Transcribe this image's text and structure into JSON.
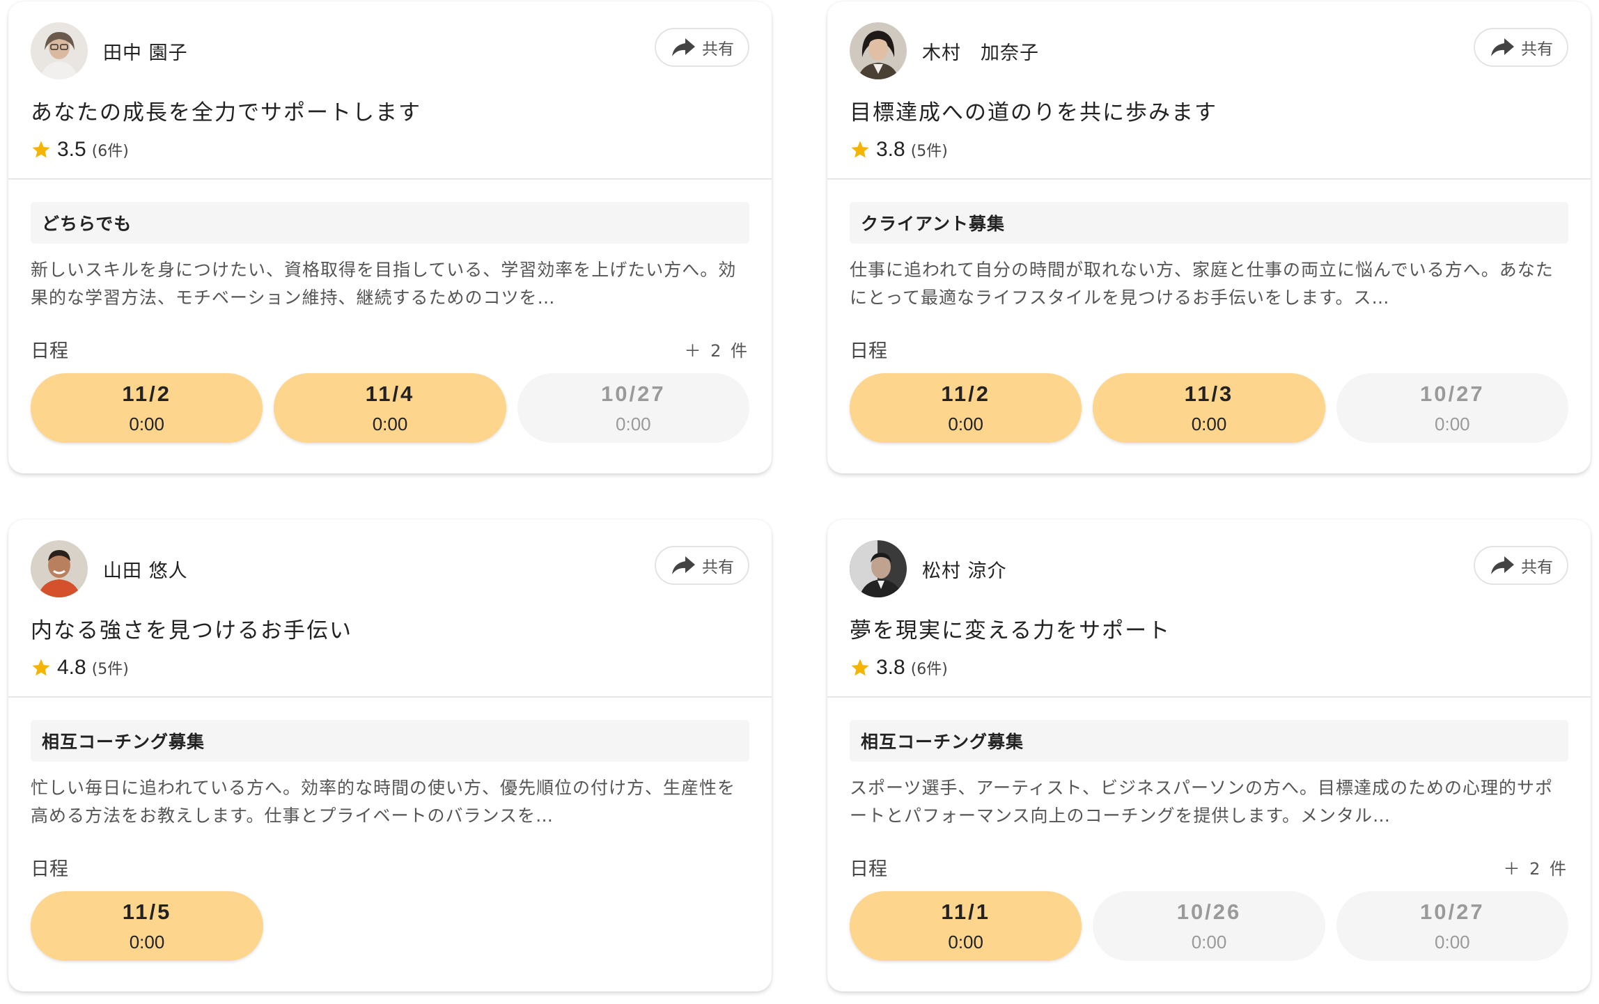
{
  "colors": {
    "accent": "#fed58c",
    "star": "#f5b400",
    "disabled": "#f5f5f5"
  },
  "share_label": "共有",
  "schedule_label": "日程",
  "cards": [
    {
      "name": "田中 園子",
      "title": "あなたの成長を全力でサポートします",
      "rating": "3.5",
      "review_count": "(6件)",
      "tag": "どちらでも",
      "description": "新しいスキルを身につけたい、資格取得を目指している、学習効率を上げたい方へ。効果的な学習方法、モチベーション維持、継続するためのコツを…",
      "more": "＋ 2 件",
      "slots": [
        {
          "date": "11/2",
          "time": "0:00",
          "available": true
        },
        {
          "date": "11/4",
          "time": "0:00",
          "available": true
        },
        {
          "date": "10/27",
          "time": "0:00",
          "available": false
        }
      ]
    },
    {
      "name": "木村　加奈子",
      "title": "目標達成への道のりを共に歩みます",
      "rating": "3.8",
      "review_count": "(5件)",
      "tag": "クライアント募集",
      "description": "仕事に追われて自分の時間が取れない方、家庭と仕事の両立に悩んでいる方へ。あなたにとって最適なライフスタイルを見つけるお手伝いをします。ス…",
      "more": "",
      "slots": [
        {
          "date": "11/2",
          "time": "0:00",
          "available": true
        },
        {
          "date": "11/3",
          "time": "0:00",
          "available": true
        },
        {
          "date": "10/27",
          "time": "0:00",
          "available": false
        }
      ]
    },
    {
      "name": "山田 悠人",
      "title": "内なる強さを見つけるお手伝い",
      "rating": "4.8",
      "review_count": "(5件)",
      "tag": "相互コーチング募集",
      "description": "忙しい毎日に追われている方へ。効率的な時間の使い方、優先順位の付け方、生産性を高める方法をお教えします。仕事とプライベートのバランスを…",
      "more": "",
      "slots": [
        {
          "date": "11/5",
          "time": "0:00",
          "available": true
        }
      ]
    },
    {
      "name": "松村 涼介",
      "title": "夢を現実に変える力をサポート",
      "rating": "3.8",
      "review_count": "(6件)",
      "tag": "相互コーチング募集",
      "description": "スポーツ選手、アーティスト、ビジネスパーソンの方へ。目標達成のための心理的サポートとパフォーマンス向上のコーチングを提供します。メンタル…",
      "more": "＋ 2 件",
      "slots": [
        {
          "date": "11/1",
          "time": "0:00",
          "available": true
        },
        {
          "date": "10/26",
          "time": "0:00",
          "available": false
        },
        {
          "date": "10/27",
          "time": "0:00",
          "available": false
        }
      ]
    }
  ]
}
